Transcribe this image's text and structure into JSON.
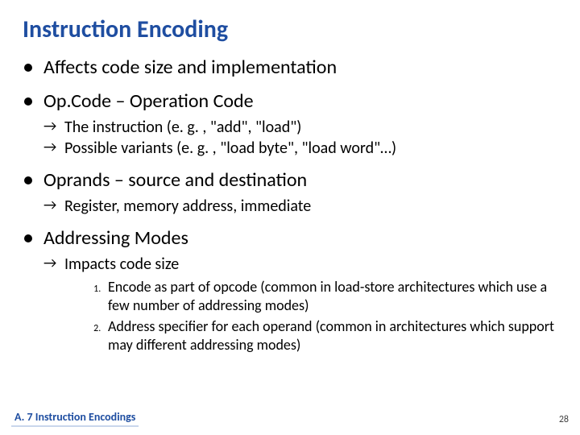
{
  "title": "Instruction Encoding",
  "bullets": {
    "b1": "Affects code size and implementation",
    "b2": "Op.Code – Operation Code",
    "b2_sub": {
      "s1": "The instruction (e. g. , \"add\", \"load\")",
      "s2": "Possible variants (e. g. , \"load byte\", \"load word\"…)"
    },
    "b3": "Oprands – source and destination",
    "b3_sub": {
      "s1": "Register, memory address, immediate"
    },
    "b4": "Addressing Modes",
    "b4_sub": {
      "s1": "Impacts code size"
    },
    "b4_num": {
      "n1": "Encode as part of opcode (common in load-store architectures which use a few number of addressing modes)",
      "n2": "Address specifier for each operand (common in architectures which support may different addressing modes)"
    }
  },
  "footer": "A. 7  Instruction Encodings",
  "page": "28"
}
